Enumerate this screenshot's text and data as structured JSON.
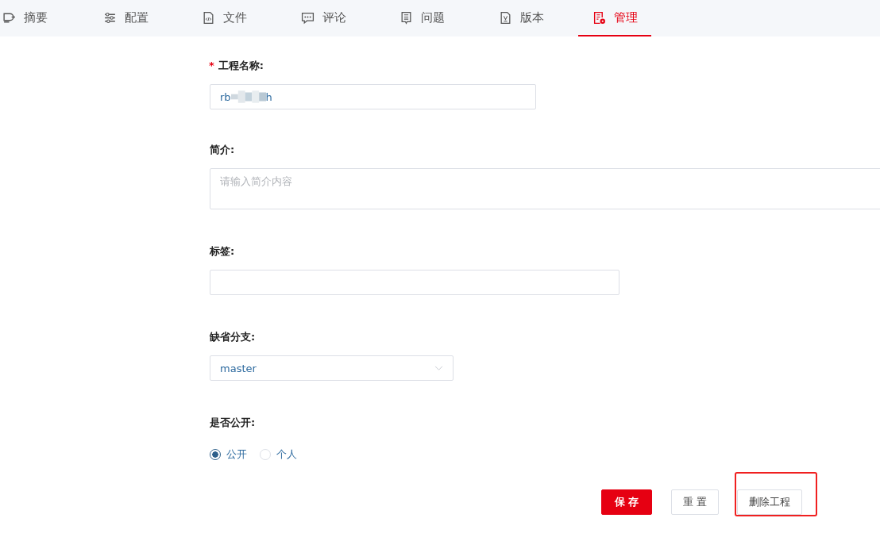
{
  "tabs": [
    {
      "label": "摘要",
      "selected": false
    },
    {
      "label": "配置",
      "selected": false
    },
    {
      "label": "文件",
      "selected": false
    },
    {
      "label": "评论",
      "selected": false
    },
    {
      "label": "问题",
      "selected": false
    },
    {
      "label": "版本",
      "selected": false
    },
    {
      "label": "管理",
      "selected": true
    }
  ],
  "form": {
    "name": {
      "label": "工程名称:",
      "required_mark": "*",
      "value_start": "rb",
      "value_end": "h"
    },
    "description": {
      "label": "简介:",
      "placeholder": "请输入简介内容"
    },
    "tags": {
      "label": "标签:"
    },
    "branch": {
      "label": "缺省分支:",
      "value": "master"
    },
    "visibility": {
      "label": "是否公开:",
      "options": [
        {
          "label": "公开",
          "selected": true
        },
        {
          "label": "个人",
          "selected": false
        }
      ]
    }
  },
  "buttons": [
    {
      "label": "保 存",
      "kind": "primary",
      "highlighted": false
    },
    {
      "label": "重 置",
      "kind": "plain",
      "highlighted": false
    },
    {
      "label": "删除工程",
      "kind": "plain",
      "highlighted": true
    }
  ]
}
